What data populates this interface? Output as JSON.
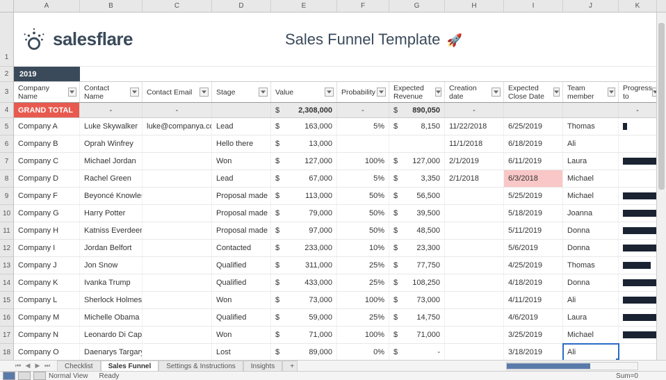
{
  "columns": [
    "A",
    "B",
    "C",
    "D",
    "E",
    "F",
    "G",
    "H",
    "I",
    "J",
    "K"
  ],
  "logo_text": "salesflare",
  "title": "Sales Funnel Template",
  "year": "2019",
  "headers": {
    "company": "Company Name",
    "contact": "Contact Name",
    "email": "Contact Email",
    "stage": "Stage",
    "value": "Value",
    "probability": "Probability",
    "expected_revenue": "Expected Revenue",
    "creation_date": "Creation date",
    "expected_close": "Expected Close Date",
    "team_member": "Team member",
    "progress": "Progress to"
  },
  "grand_total": {
    "label": "GRAND TOTAL",
    "contact": "-",
    "email": "-",
    "stage": "",
    "value_sym": "$",
    "value": "2,308,000",
    "probability": "-",
    "exprev_sym": "$",
    "exprev": "890,050",
    "creation": "-",
    "expclose": "",
    "team": "",
    "progress": "-"
  },
  "rows": [
    {
      "company": "Company A",
      "contact": "Luke Skywalker",
      "email": "luke@companya.com",
      "stage": "Lead",
      "val": "163,000",
      "prob": "5%",
      "exprev": "8,150",
      "created": "11/22/2018",
      "expclose": "6/25/2019",
      "team": "Thomas",
      "bar": 6,
      "alert": false
    },
    {
      "company": "Company B",
      "contact": "Oprah Winfrey",
      "email": "",
      "stage": "Hello there",
      "val": "13,000",
      "prob": "",
      "exprev": "",
      "created": "11/1/2018",
      "expclose": "6/18/2019",
      "team": "Ali",
      "bar": 0,
      "alert": false
    },
    {
      "company": "Company C",
      "contact": "Michael Jordan",
      "email": "",
      "stage": "Won",
      "val": "127,000",
      "prob": "100%",
      "exprev": "127,000",
      "created": "2/1/2019",
      "expclose": "6/11/2019",
      "team": "Laura",
      "bar": 55,
      "alert": false
    },
    {
      "company": "Company D",
      "contact": "Rachel Green",
      "email": "",
      "stage": "Lead",
      "val": "67,000",
      "prob": "5%",
      "exprev": "3,350",
      "created": "2/1/2018",
      "expclose": "6/3/2018",
      "team": "Michael",
      "bar": 0,
      "alert": true
    },
    {
      "company": "Company F",
      "contact": "Beyoncé Knowles",
      "email": "",
      "stage": "Proposal made",
      "val": "113,000",
      "prob": "50%",
      "exprev": "56,500",
      "created": "",
      "expclose": "5/25/2019",
      "team": "Michael",
      "bar": 55,
      "alert": false
    },
    {
      "company": "Company G",
      "contact": "Harry Potter",
      "email": "",
      "stage": "Proposal made",
      "val": "79,000",
      "prob": "50%",
      "exprev": "39,500",
      "created": "",
      "expclose": "5/18/2019",
      "team": "Joanna",
      "bar": 55,
      "alert": false
    },
    {
      "company": "Company H",
      "contact": "Katniss Everdeen",
      "email": "",
      "stage": "Proposal made",
      "val": "97,000",
      "prob": "50%",
      "exprev": "48,500",
      "created": "",
      "expclose": "5/11/2019",
      "team": "Donna",
      "bar": 55,
      "alert": false
    },
    {
      "company": "Company I",
      "contact": "Jordan Belfort",
      "email": "",
      "stage": "Contacted",
      "val": "233,000",
      "prob": "10%",
      "exprev": "23,300",
      "created": "",
      "expclose": "5/6/2019",
      "team": "Donna",
      "bar": 55,
      "alert": false
    },
    {
      "company": "Company J",
      "contact": "Jon Snow",
      "email": "",
      "stage": "Qualified",
      "val": "311,000",
      "prob": "25%",
      "exprev": "77,750",
      "created": "",
      "expclose": "4/25/2019",
      "team": "Thomas",
      "bar": 40,
      "alert": false
    },
    {
      "company": "Company K",
      "contact": "Ivanka Trump",
      "email": "",
      "stage": "Qualified",
      "val": "433,000",
      "prob": "25%",
      "exprev": "108,250",
      "created": "",
      "expclose": "4/18/2019",
      "team": "Donna",
      "bar": 55,
      "alert": false
    },
    {
      "company": "Company L",
      "contact": "Sherlock Holmes",
      "email": "",
      "stage": "Won",
      "val": "73,000",
      "prob": "100%",
      "exprev": "73,000",
      "created": "",
      "expclose": "4/11/2019",
      "team": "Ali",
      "bar": 55,
      "alert": false
    },
    {
      "company": "Company M",
      "contact": "Michelle Obama",
      "email": "",
      "stage": "Qualified",
      "val": "59,000",
      "prob": "25%",
      "exprev": "14,750",
      "created": "",
      "expclose": "4/6/2019",
      "team": "Laura",
      "bar": 55,
      "alert": false
    },
    {
      "company": "Company N",
      "contact": "Leonardo Di Caprio",
      "email": "",
      "stage": "Won",
      "val": "71,000",
      "prob": "100%",
      "exprev": "71,000",
      "created": "",
      "expclose": "3/25/2019",
      "team": "Michael",
      "bar": 55,
      "alert": false
    },
    {
      "company": "Company O",
      "contact": "Daenarys Targaryen",
      "email": "",
      "stage": "Lost",
      "val": "89,000",
      "prob": "0%",
      "exprev": "-",
      "created": "",
      "expclose": "3/18/2019",
      "team": "Ali",
      "bar": 0,
      "alert": false,
      "selected": true
    }
  ],
  "sheet_tabs": [
    "Checklist",
    "Sales Funnel",
    "Settings & Instructions",
    "Insights"
  ],
  "active_tab": 1,
  "status": {
    "view_label": "Normal View",
    "ready": "Ready",
    "sum": "Sum=0"
  }
}
